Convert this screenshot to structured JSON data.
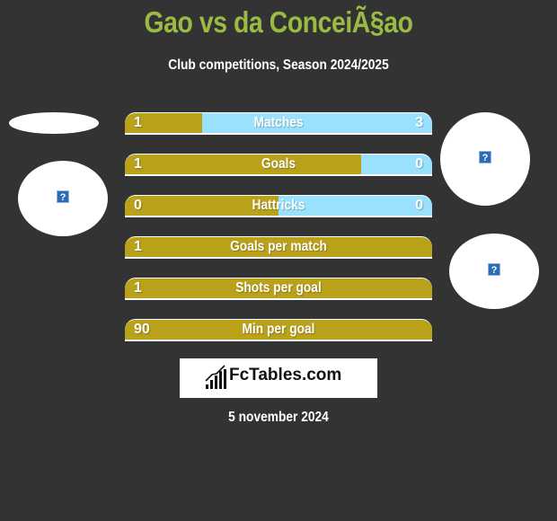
{
  "header": {
    "title": "Gao vs da ConceiÃ§ao",
    "subtitle": "Club competitions, Season 2024/2025"
  },
  "colors": {
    "left_player": "#b9a11a",
    "right_player": "#99e1fc",
    "title": "#99bb44",
    "background": "#333333"
  },
  "stats": [
    {
      "label": "Matches",
      "left": "1",
      "right": "3",
      "left_share": 0.25
    },
    {
      "label": "Goals",
      "left": "1",
      "right": "0",
      "left_share": 0.77
    },
    {
      "label": "Hattricks",
      "left": "0",
      "right": "0",
      "left_share": 0.5
    },
    {
      "label": "Goals per match",
      "left": "1",
      "right": null,
      "left_share": 1.0
    },
    {
      "label": "Shots per goal",
      "left": "1",
      "right": null,
      "left_share": 1.0
    },
    {
      "label": "Min per goal",
      "left": "90",
      "right": null,
      "left_share": 1.0
    }
  ],
  "images": {
    "left_logo": "broken-image-icon",
    "right_logo": "broken-image-icon",
    "right_logo_2": "broken-image-icon"
  },
  "branding": {
    "logo_text": "FcTables.com",
    "logo_icon": "bar-chart-icon"
  },
  "footer": {
    "date": "5 november 2024"
  }
}
